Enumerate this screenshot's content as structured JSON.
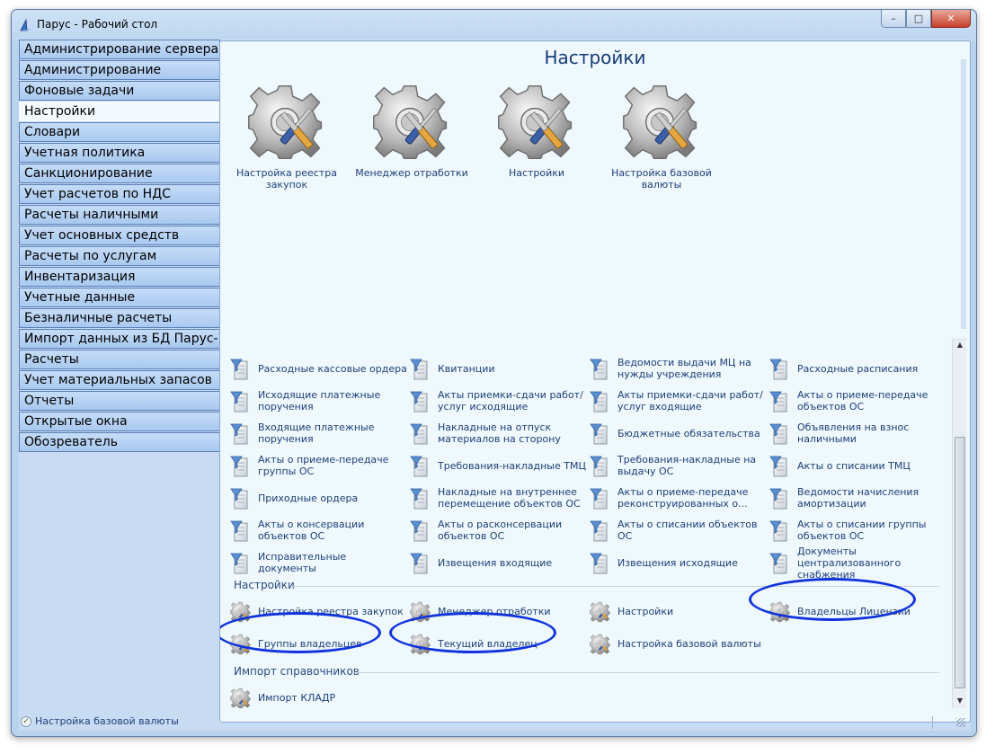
{
  "window": {
    "title": "Парус - Рабочий стол"
  },
  "sidebar": {
    "items": [
      {
        "label": "Администрирование сервера",
        "active": false
      },
      {
        "label": "Администрирование",
        "active": false
      },
      {
        "label": "Фоновые задачи",
        "active": false
      },
      {
        "label": "Настройки",
        "active": true
      },
      {
        "label": "Словари",
        "active": false
      },
      {
        "label": "Учетная политика",
        "active": false
      },
      {
        "label": "Санкционирование",
        "active": false
      },
      {
        "label": "Учет расчетов по НДС",
        "active": false
      },
      {
        "label": "Расчеты наличными",
        "active": false
      },
      {
        "label": "Учет основных средств",
        "active": false
      },
      {
        "label": "Расчеты по услугам",
        "active": false
      },
      {
        "label": "Инвентаризация",
        "active": false
      },
      {
        "label": "Учетные данные",
        "active": false
      },
      {
        "label": "Безналичные расчеты",
        "active": false
      },
      {
        "label": "Импорт данных из БД Парус-7",
        "active": false
      },
      {
        "label": "Расчеты",
        "active": false
      },
      {
        "label": "Учет материальных запасов",
        "active": false
      },
      {
        "label": "Отчеты",
        "active": false
      },
      {
        "label": "Открытые окна",
        "active": false
      },
      {
        "label": "Обозреватель",
        "active": false
      }
    ]
  },
  "content": {
    "title": "Настройки",
    "big_icons": [
      {
        "label": "Настройка реестра закупок",
        "icon": "gear-tools-icon"
      },
      {
        "label": "Менеджер отработки",
        "icon": "gear-tools-icon"
      },
      {
        "label": "Настройки",
        "icon": "gear-tools-icon"
      },
      {
        "label": "Настройка базовой валюты",
        "icon": "gear-tools-icon"
      }
    ],
    "documents": [
      [
        "Расходные кассовые ордера",
        "Квитанции",
        "Ведомости выдачи МЦ на нужды учреждения",
        "Расходные расписания"
      ],
      [
        "Исходящие платежные поручения",
        "Акты приемки-сдачи работ/услуг исходящие",
        "Акты приемки-сдачи работ/услуг входящие",
        "Акты о приеме-передаче объектов ОС"
      ],
      [
        "Входящие платежные поручения",
        "Накладные на отпуск материалов на сторону",
        "Бюджетные обязательства",
        "Объявления на взнос наличными"
      ],
      [
        "Акты о приеме-передаче группы ОС",
        "Требования-накладные ТМЦ",
        "Требования-накладные на выдачу ОС",
        "Акты о списании ТМЦ"
      ],
      [
        "Приходные ордера",
        "Накладные на внутреннее перемещение объектов ОС",
        "Акты о приеме-передаче реконструированных о...",
        "Ведомости начисления амортизации"
      ],
      [
        "Акты о консервации объектов ОС",
        "Акты о расконсервации объектов ОС",
        "Акты о списании объектов ОС",
        "Акты о списании группы объектов ОС"
      ],
      [
        "Исправительные документы",
        "Извещения входящие",
        "Извещения исходящие",
        "Документы централизованного снабжения"
      ]
    ],
    "settings_section": {
      "title": "Настройки",
      "items": [
        [
          "Настройка реестра закупок",
          "Менеджер отработки",
          "Настройки",
          "Владельцы Лицензий"
        ],
        [
          "Группы владельцев",
          "Текущий владелец",
          "Настройка базовой валюты"
        ]
      ]
    },
    "import_section": {
      "title": "Импорт справочников",
      "items": [
        "Импорт КЛАДР"
      ]
    }
  },
  "statusbar": {
    "text": "Настройка базовой валюты"
  },
  "colors": {
    "accent_ring": "#1133dd",
    "title_blue": "#1a3b79",
    "nav_bg": "#b3d0f2"
  }
}
